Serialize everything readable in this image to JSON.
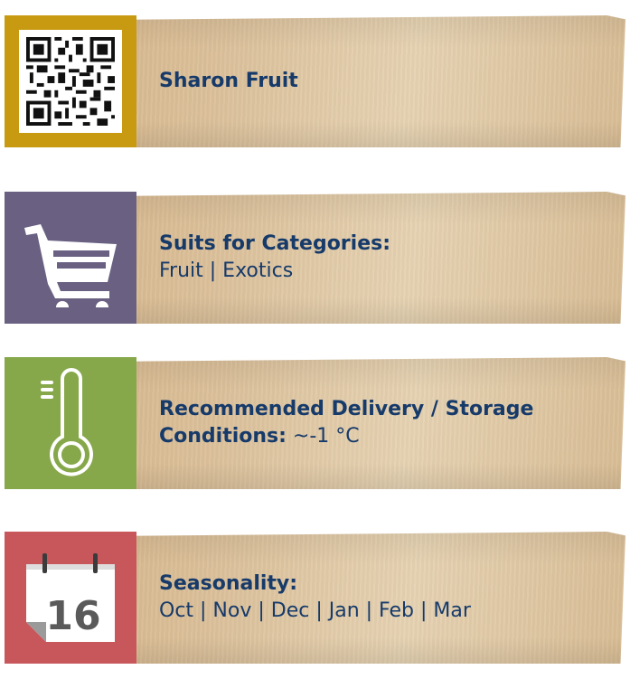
{
  "colors": {
    "qr_badge": "#c79a12",
    "cart_badge": "#6a6182",
    "thermo_badge": "#86a84a",
    "calendar_badge": "#c8575b",
    "text": "#163a6a"
  },
  "product": {
    "name": "Sharon Fruit"
  },
  "categories": {
    "label": "Suits for Categories:",
    "value": "Fruit | Exotics"
  },
  "storage": {
    "label": "Recommended Delivery / Storage",
    "label_line2": "Conditions:",
    "value": " ~-1 °C"
  },
  "seasonality": {
    "label": "Seasonality:",
    "value": "Oct | Nov | Dec | Jan | Feb | Mar",
    "calendar_day": "16"
  },
  "icons": [
    "qr-code-icon",
    "shopping-cart-icon",
    "thermometer-icon",
    "calendar-icon"
  ]
}
